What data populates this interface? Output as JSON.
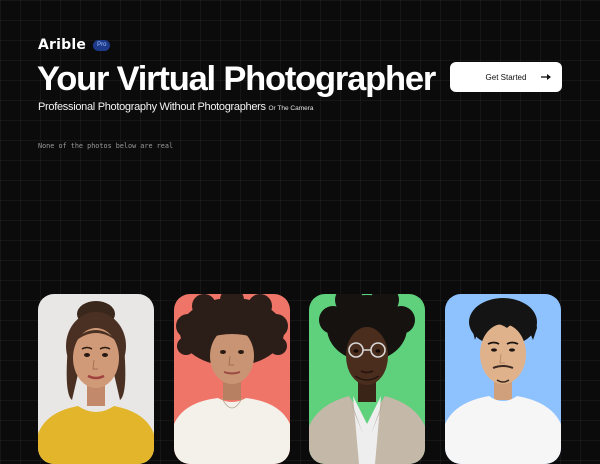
{
  "brand": {
    "name": "Arible",
    "badge": "Pro"
  },
  "hero": {
    "title": "Your Virtual Photographer",
    "subtitle": "Professional Photography Without Photographers",
    "subtitle_small": "Or The Camera"
  },
  "cta": {
    "label": "Get Started",
    "icon": "arrow-right-icon"
  },
  "disclaimer": "None of the photos below are real",
  "cards": [
    {
      "name": "woman-updo-yellow-sweater",
      "bg": "#e8e7e6"
    },
    {
      "name": "woman-curly-bangs-white-top",
      "bg": "#f07569"
    },
    {
      "name": "man-afro-glasses-blazer",
      "bg": "#5fd07c"
    },
    {
      "name": "man-short-hair-white-tee",
      "bg": "#8ec2ff"
    }
  ],
  "colors": {
    "background": "#0b0b0b",
    "accent": "#1e3a8a",
    "button": "#ffffff"
  }
}
